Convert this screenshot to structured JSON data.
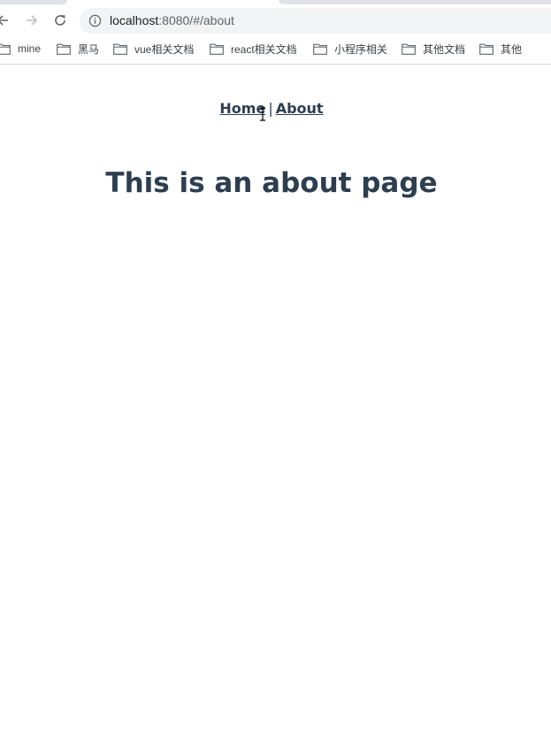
{
  "browser": {
    "url_host": "localhost",
    "url_rest": ":8080/#/about",
    "icons": {
      "back": "arrow-left-icon",
      "forward": "arrow-right-icon",
      "reload": "reload-icon",
      "site_info": "info-icon"
    }
  },
  "bookmarks": [
    {
      "label": "mine"
    },
    {
      "label": "黑马"
    },
    {
      "label": "vue相关文档"
    },
    {
      "label": "react相关文档"
    },
    {
      "label": "小程序相关"
    },
    {
      "label": "其他文档"
    },
    {
      "label": "其他"
    }
  ],
  "page": {
    "nav": {
      "home_label": "Home",
      "separator": "|",
      "about_label": "About"
    },
    "heading": "This is an about page"
  },
  "colors": {
    "text": "#2c3e50",
    "omnibox": "#f1f3f4",
    "toolbar_icon": "#5f6368"
  }
}
